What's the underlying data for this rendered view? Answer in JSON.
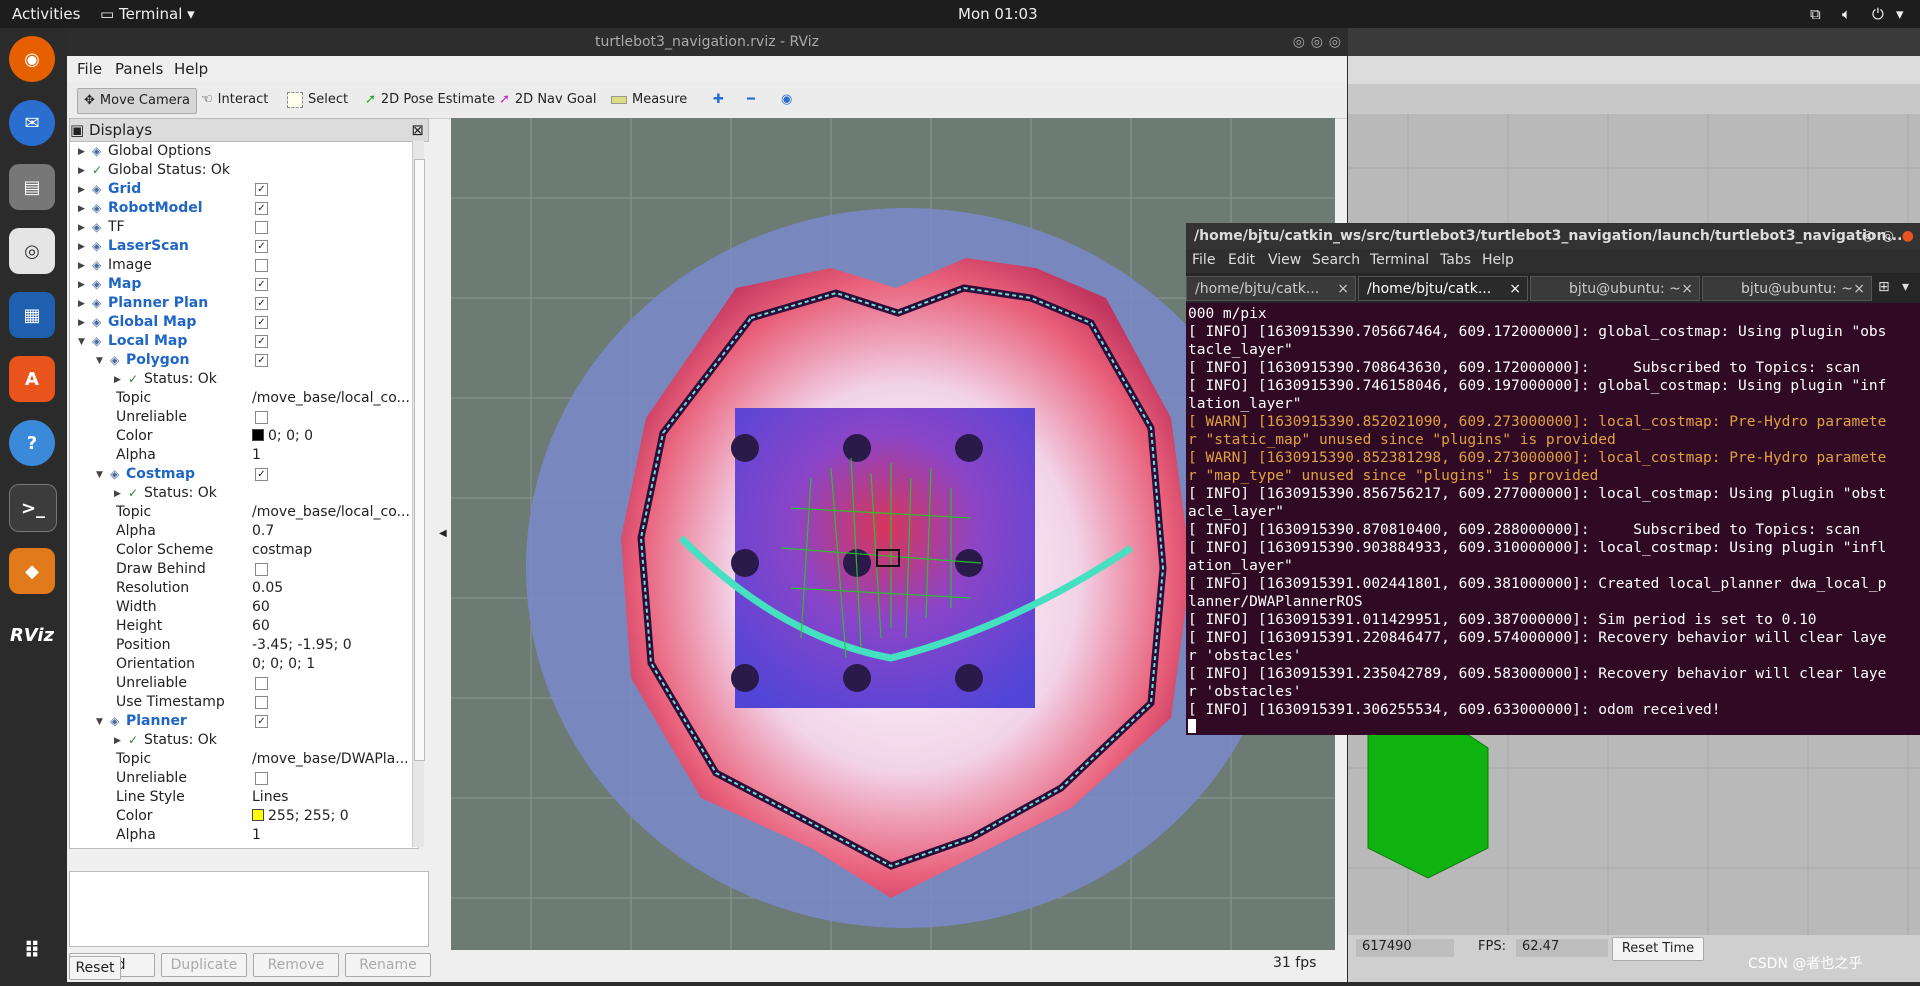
{
  "topbar": {
    "activities": "Activities",
    "app": "Terminal",
    "clock": "Mon 01:03"
  },
  "rviz": {
    "window_title": "turtlebot3_navigation.rviz - RViz",
    "menu": [
      "File",
      "Panels",
      "Help"
    ],
    "tools": [
      "Move Camera",
      "Interact",
      "Select",
      "2D Pose Estimate",
      "2D Nav Goal",
      "Measure"
    ],
    "panel_title": "Displays",
    "tree": [
      {
        "name": "Global Options",
        "depth": 0,
        "style": "normal",
        "value": "",
        "checkbox": null
      },
      {
        "name": "Global Status: Ok",
        "depth": 0,
        "style": "normal",
        "value": "",
        "checkbox": null,
        "check": true
      },
      {
        "name": "Grid",
        "depth": 0,
        "style": "blue",
        "value": "",
        "checkbox": true
      },
      {
        "name": "RobotModel",
        "depth": 0,
        "style": "blue",
        "value": "",
        "checkbox": true
      },
      {
        "name": "TF",
        "depth": 0,
        "style": "normal",
        "value": "",
        "checkbox": false
      },
      {
        "name": "LaserScan",
        "depth": 0,
        "style": "blue",
        "value": "",
        "checkbox": true
      },
      {
        "name": "Image",
        "depth": 0,
        "style": "normal",
        "value": "",
        "checkbox": false
      },
      {
        "name": "Map",
        "depth": 0,
        "style": "blue",
        "value": "",
        "checkbox": true
      },
      {
        "name": "Planner Plan",
        "depth": 0,
        "style": "blue",
        "value": "",
        "checkbox": true
      },
      {
        "name": "Global Map",
        "depth": 0,
        "style": "blue",
        "value": "",
        "checkbox": true
      },
      {
        "name": "Local Map",
        "depth": 0,
        "style": "blue",
        "value": "",
        "checkbox": true,
        "expanded": true
      },
      {
        "name": "Polygon",
        "depth": 1,
        "style": "blue",
        "value": "",
        "checkbox": true,
        "expanded": true
      },
      {
        "name": "Status: Ok",
        "depth": 2,
        "style": "normal",
        "value": "",
        "checkbox": null,
        "check": true
      },
      {
        "name": "Topic",
        "depth": 2,
        "style": "plain",
        "value": "/move_base/local_co...",
        "checkbox": null
      },
      {
        "name": "Unreliable",
        "depth": 2,
        "style": "plain",
        "value": "",
        "checkbox": false
      },
      {
        "name": "Color",
        "depth": 2,
        "style": "plain",
        "value": "0; 0; 0",
        "checkbox": null,
        "swatch": "#000000"
      },
      {
        "name": "Alpha",
        "depth": 2,
        "style": "plain",
        "value": "1",
        "checkbox": null
      },
      {
        "name": "Costmap",
        "depth": 1,
        "style": "blue",
        "value": "",
        "checkbox": true,
        "expanded": true
      },
      {
        "name": "Status: Ok",
        "depth": 2,
        "style": "normal",
        "value": "",
        "checkbox": null,
        "check": true
      },
      {
        "name": "Topic",
        "depth": 2,
        "style": "plain",
        "value": "/move_base/local_co...",
        "checkbox": null
      },
      {
        "name": "Alpha",
        "depth": 2,
        "style": "plain",
        "value": "0.7",
        "checkbox": null
      },
      {
        "name": "Color Scheme",
        "depth": 2,
        "style": "plain",
        "value": "costmap",
        "checkbox": null
      },
      {
        "name": "Draw Behind",
        "depth": 2,
        "style": "plain",
        "value": "",
        "checkbox": false
      },
      {
        "name": "Resolution",
        "depth": 2,
        "style": "plain",
        "value": "0.05",
        "checkbox": null
      },
      {
        "name": "Width",
        "depth": 2,
        "style": "plain",
        "value": "60",
        "checkbox": null
      },
      {
        "name": "Height",
        "depth": 2,
        "style": "plain",
        "value": "60",
        "checkbox": null
      },
      {
        "name": "Position",
        "depth": 2,
        "style": "plain",
        "value": "-3.45; -1.95; 0",
        "checkbox": null
      },
      {
        "name": "Orientation",
        "depth": 2,
        "style": "plain",
        "value": "0; 0; 0; 1",
        "checkbox": null
      },
      {
        "name": "Unreliable",
        "depth": 2,
        "style": "plain",
        "value": "",
        "checkbox": false
      },
      {
        "name": "Use Timestamp",
        "depth": 2,
        "style": "plain",
        "value": "",
        "checkbox": false
      },
      {
        "name": "Planner",
        "depth": 1,
        "style": "blue",
        "value": "",
        "checkbox": true,
        "expanded": true
      },
      {
        "name": "Status: Ok",
        "depth": 2,
        "style": "normal",
        "value": "",
        "checkbox": null,
        "check": true
      },
      {
        "name": "Topic",
        "depth": 2,
        "style": "plain",
        "value": "/move_base/DWAPla...",
        "checkbox": null
      },
      {
        "name": "Unreliable",
        "depth": 2,
        "style": "plain",
        "value": "",
        "checkbox": false
      },
      {
        "name": "Line Style",
        "depth": 2,
        "style": "plain",
        "value": "Lines",
        "checkbox": null
      },
      {
        "name": "Color",
        "depth": 2,
        "style": "plain",
        "value": "255; 255; 0",
        "checkbox": null,
        "swatch": "#ffff00"
      },
      {
        "name": "Alpha",
        "depth": 2,
        "style": "plain",
        "value": "1",
        "checkbox": null
      }
    ],
    "buttons": {
      "add": "Add",
      "duplicate": "Duplicate",
      "remove": "Remove",
      "rename": "Rename",
      "reset": "Reset"
    },
    "fps": "31 fps"
  },
  "terminal": {
    "title": "/home/bjtu/catkin_ws/src/turtlebot3/turtlebot3_navigation/launch/turtlebot3_navigation....",
    "menu": [
      "File",
      "Edit",
      "View",
      "Search",
      "Terminal",
      "Tabs",
      "Help"
    ],
    "tabs": [
      "/home/bjtu/catk...",
      "/home/bjtu/catk...",
      "bjtu@ubuntu: ~",
      "bjtu@ubuntu: ~"
    ],
    "lines": [
      {
        "t": "000 m/pix",
        "w": false
      },
      {
        "t": "[ INFO] [1630915390.705667464, 609.172000000]: global_costmap: Using plugin \"obs",
        "w": false
      },
      {
        "t": "tacle_layer\"",
        "w": false
      },
      {
        "t": "[ INFO] [1630915390.708643630, 609.172000000]:     Subscribed to Topics: scan",
        "w": false
      },
      {
        "t": "[ INFO] [1630915390.746158046, 609.197000000]: global_costmap: Using plugin \"inf",
        "w": false
      },
      {
        "t": "lation_layer\"",
        "w": false
      },
      {
        "t": "[ WARN] [1630915390.852021090, 609.273000000]: local_costmap: Pre-Hydro paramete",
        "w": true
      },
      {
        "t": "r \"static_map\" unused since \"plugins\" is provided",
        "w": true
      },
      {
        "t": "[ WARN] [1630915390.852381298, 609.273000000]: local_costmap: Pre-Hydro paramete",
        "w": true
      },
      {
        "t": "r \"map_type\" unused since \"plugins\" is provided",
        "w": true
      },
      {
        "t": "[ INFO] [1630915390.856756217, 609.277000000]: local_costmap: Using plugin \"obst",
        "w": false
      },
      {
        "t": "acle_layer\"",
        "w": false
      },
      {
        "t": "[ INFO] [1630915390.870810400, 609.288000000]:     Subscribed to Topics: scan",
        "w": false
      },
      {
        "t": "[ INFO] [1630915390.903884933, 609.310000000]: local_costmap: Using plugin \"infl",
        "w": false
      },
      {
        "t": "ation_layer\"",
        "w": false
      },
      {
        "t": "[ INFO] [1630915391.002441801, 609.381000000]: Created local_planner dwa_local_p",
        "w": false
      },
      {
        "t": "lanner/DWAPlannerROS",
        "w": false
      },
      {
        "t": "[ INFO] [1630915391.011429951, 609.387000000]: Sim period is set to 0.10",
        "w": false
      },
      {
        "t": "[ INFO] [1630915391.220846477, 609.574000000]: Recovery behavior will clear laye",
        "w": false
      },
      {
        "t": "r 'obstacles'",
        "w": false
      },
      {
        "t": "[ INFO] [1630915391.235042789, 609.583000000]: Recovery behavior will clear laye",
        "w": false
      },
      {
        "t": "r 'obstacles'",
        "w": false
      },
      {
        "t": "[ INFO] [1630915391.306255534, 609.633000000]: odom received!",
        "w": false
      }
    ]
  },
  "gazebo": {
    "sim_value": "617490",
    "fps_label": "FPS:",
    "fps_value": "62.47",
    "reset_time": "Reset Time",
    "watermark": "CSDN @者也之乎"
  }
}
